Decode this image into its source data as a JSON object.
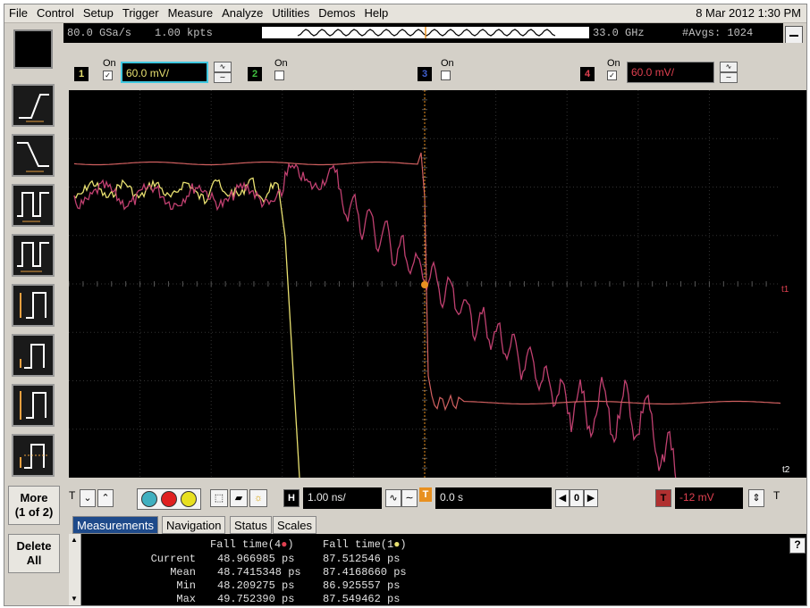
{
  "menu": {
    "items": [
      "File",
      "Control",
      "Setup",
      "Trigger",
      "Measure",
      "Analyze",
      "Utilities",
      "Demos",
      "Help"
    ],
    "datetime": "8 Mar 2012  1:30 PM"
  },
  "acquisition": {
    "sample_rate": "80.0 GSa/s",
    "record_length": "1.00 kpts",
    "bandwidth": "33.0 GHz",
    "averages": "#Avgs: 1024"
  },
  "channels": [
    {
      "number": "1",
      "on_label": "On",
      "checked": true,
      "scale": "60.0 mV/",
      "color": "#e8e070"
    },
    {
      "number": "2",
      "on_label": "On",
      "checked": false,
      "scale": "",
      "color": "#40c040"
    },
    {
      "number": "3",
      "on_label": "On",
      "checked": false,
      "scale": "",
      "color": "#4060d0"
    },
    {
      "number": "4",
      "on_label": "On",
      "checked": true,
      "scale": "60.0 mV/",
      "color": "#e04050"
    }
  ],
  "left_panel": {
    "more_label": "More",
    "more_page": "(1 of 2)",
    "delete_label": "Delete",
    "delete_all": "All"
  },
  "markers": {
    "t1": "t1",
    "t2": "t2"
  },
  "controls": {
    "trigger_marker": "T",
    "horizontal_scale_icon": "H",
    "horizontal_scale": "1.00 ns/",
    "delay_icon": "T",
    "delay": "0.0 s",
    "nav_zero": "0",
    "trigger_level_icon": "T",
    "trigger_level": "-12 mV",
    "trigger_edge": "T"
  },
  "tabs": [
    "Measurements",
    "Navigation",
    "Status",
    "Scales"
  ],
  "measurements": {
    "col1_header": "Fall time(4",
    "col2_header": "Fall time(1",
    "header_close": ")",
    "rows": [
      {
        "label": "Current",
        "v1": "48.966985 ps",
        "v2": "87.512546 ps"
      },
      {
        "label": "Mean",
        "v1": "48.7415348 ps",
        "v2": "87.4168660 ps"
      },
      {
        "label": "Min",
        "v1": "48.209275 ps",
        "v2": "86.925557 ps"
      },
      {
        "label": "Max",
        "v1": "49.752390 ps",
        "v2": "87.549462 ps"
      }
    ],
    "help": "?"
  },
  "colors": {
    "trace_yellow": "#e8e070",
    "trace_pink": "#c04070",
    "trigger_orange": "#e89020",
    "grid": "#3a3a3a",
    "tab_active": "#1e4a8a"
  }
}
